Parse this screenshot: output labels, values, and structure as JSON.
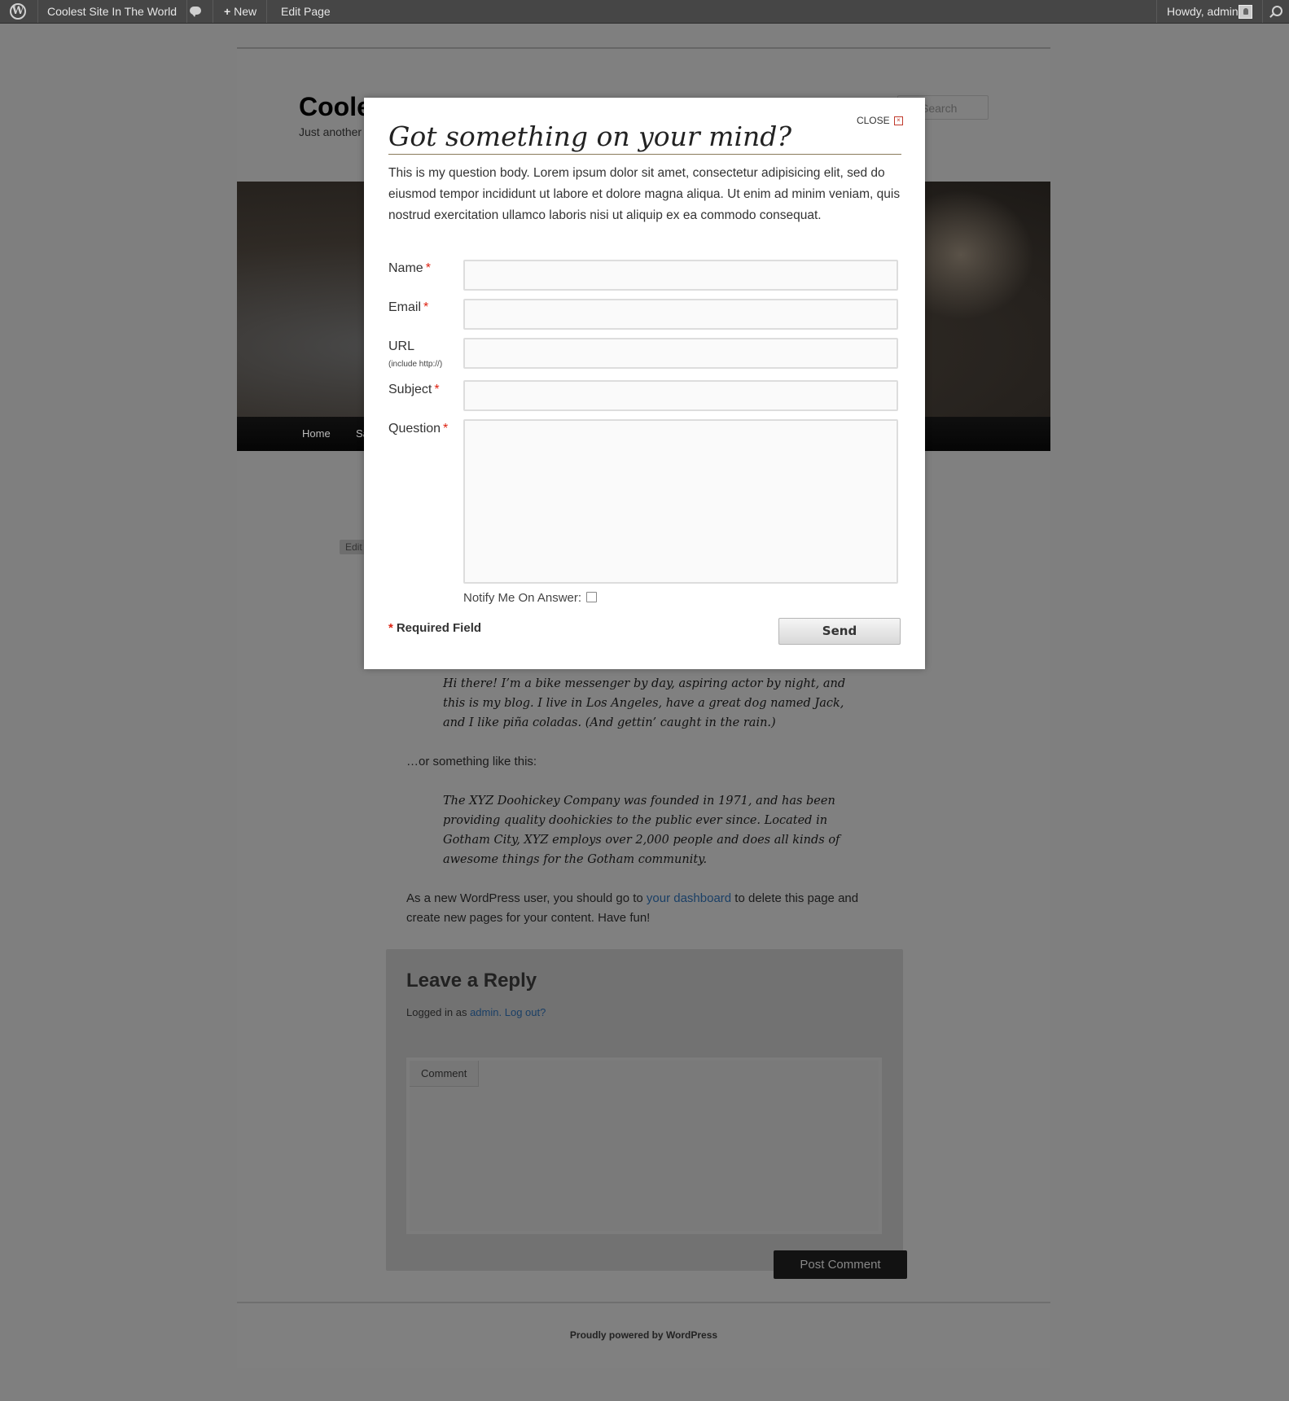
{
  "admin_bar": {
    "site_name": "Coolest Site In The World",
    "new_label": "New",
    "edit_label": "Edit Page",
    "howdy": "Howdy, admin"
  },
  "site": {
    "title": "Coole",
    "description": "Just another",
    "search_placeholder": "Search"
  },
  "nav": {
    "items": [
      "Home",
      "Sa"
    ]
  },
  "page": {
    "edit_label": "Edit",
    "quote1": "Hi there! I’m a bike messenger by day, aspiring actor by night, and this is my blog. I live in Los Angeles, have a great dog named Jack, and I like piña coladas. (And gettin’ caught in the rain.)",
    "or_text": "…or something like this:",
    "quote2": "The XYZ Doohickey Company was founded in 1971, and has been providing quality doohickies to the public ever since. Located in Gotham City, XYZ employs over 2,000 people and does all kinds of awesome things for the Gotham community.",
    "new_user_pre": "As a new WordPress user, you should go to ",
    "new_user_link": "your dashboard",
    "new_user_post": " to delete this page and create new pages for your content. Have fun!"
  },
  "comments": {
    "title": "Leave a Reply",
    "logged_in_pre": "Logged in as ",
    "logged_in_user": "admin",
    "logout": "Log out?",
    "comment_label": "Comment",
    "post_button": "Post Comment"
  },
  "footer": {
    "text": "Proudly powered by WordPress"
  },
  "modal": {
    "close_label": "CLOSE",
    "close_icon": "☒",
    "title": "Got something on your mind?",
    "body": "This is my question body. Lorem ipsum dolor sit amet, consectetur adipisicing elit, sed do eiusmod tempor incididunt ut labore et dolore magna aliqua. Ut enim ad minim veniam, quis nostrud exercitation ullamco laboris nisi ut aliquip ex ea commodo consequat.",
    "fields": {
      "name": "Name",
      "email": "Email",
      "url": "URL",
      "url_hint": "(include http://)",
      "subject": "Subject",
      "question": "Question"
    },
    "required_mark": "*",
    "notify_label": "Notify Me On Answer:",
    "required_field": "Required Field",
    "send_label": "Send"
  }
}
